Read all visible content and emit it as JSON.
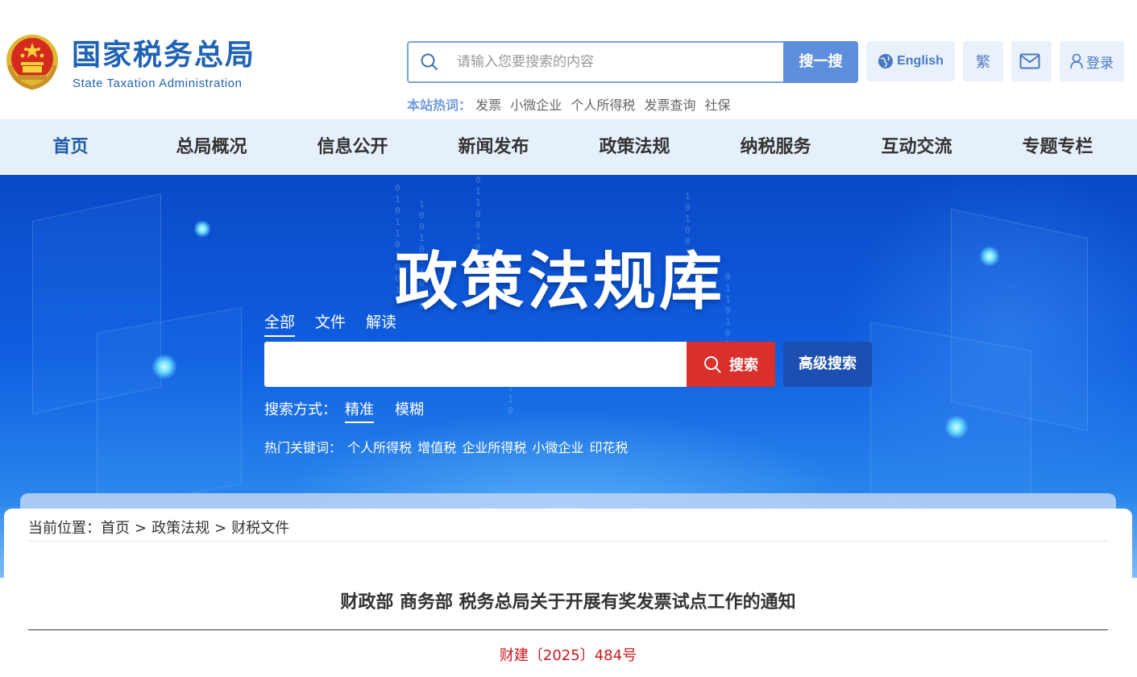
{
  "header": {
    "site_name_cn": "国家税务总局",
    "site_name_en": "State Taxation Administration",
    "search_placeholder": "请输入您要搜索的内容",
    "search_button": "搜一搜",
    "hot_label": "本站热词：",
    "hot_words": [
      "发票",
      "小微企业",
      "个人所得税",
      "发票查询",
      "社保"
    ],
    "english_label": "English",
    "traditional_label": "繁",
    "login_label": "登录"
  },
  "nav": {
    "items": [
      "首页",
      "总局概况",
      "信息公开",
      "新闻发布",
      "政策法规",
      "纳税服务",
      "互动交流",
      "专题专栏"
    ],
    "active_index": 0
  },
  "banner": {
    "title": "政策法规库",
    "tabs": [
      "全部",
      "文件",
      "解读"
    ],
    "active_tab": 0,
    "search_button": "搜索",
    "advanced_button": "高级搜索",
    "mode_label": "搜索方式：",
    "modes": [
      "精准",
      "模糊"
    ],
    "active_mode": 0,
    "hot_keys_label": "热门关键词：",
    "hot_keys": [
      "个人所得税",
      "增值税",
      "企业所得税",
      "小微企业",
      "印花税"
    ]
  },
  "breadcrumb": {
    "label": "当前位置：",
    "items": [
      "首页",
      "政策法规",
      "财税文件"
    ],
    "separator": ">"
  },
  "document": {
    "title": "财政部 商务部 税务总局关于开展有奖发票试点工作的通知",
    "number": "财建〔2025〕484号"
  },
  "colors": {
    "brand_blue": "#1f63b4",
    "nav_bg": "#e6f0fb",
    "search_red": "#d9302b",
    "advanced_blue": "#1c4fb1",
    "doc_number_red": "#c8161d"
  }
}
